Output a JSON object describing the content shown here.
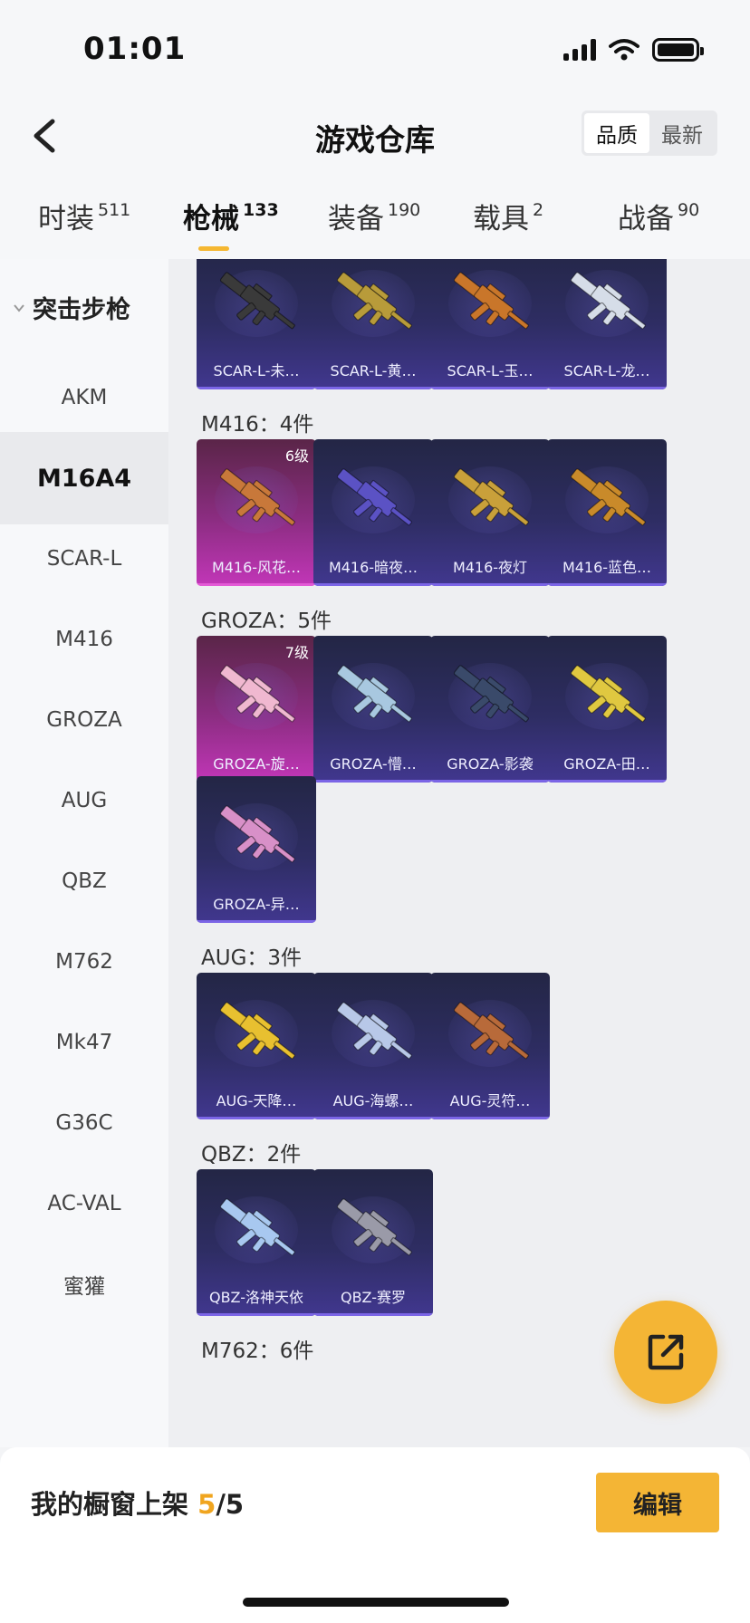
{
  "status": {
    "time": "01:01"
  },
  "nav": {
    "title": "游戏仓库",
    "sort_options": [
      "品质",
      "最新"
    ],
    "sort_active": 0
  },
  "categories": [
    {
      "label": "时装",
      "count": "511"
    },
    {
      "label": "枪械",
      "count": "133"
    },
    {
      "label": "装备",
      "count": "190"
    },
    {
      "label": "载具",
      "count": "2"
    },
    {
      "label": "战备",
      "count": "90"
    }
  ],
  "sidebar": {
    "group": "突击步枪",
    "items": [
      "AKM",
      "M16A4",
      "SCAR-L",
      "M416",
      "GROZA",
      "AUG",
      "QBZ",
      "M762",
      "Mk47",
      "G36C",
      "AC-VAL",
      "蜜獾"
    ],
    "active": "M16A4"
  },
  "sections": [
    {
      "label": "",
      "cards": [
        {
          "name": "SCAR-L-未…",
          "level": "",
          "color": "#3a3a3a"
        },
        {
          "name": "SCAR-L-黄…",
          "level": "",
          "color": "#b89b3a"
        },
        {
          "name": "SCAR-L-玉…",
          "level": "",
          "color": "#c9762a"
        },
        {
          "name": "SCAR-L-龙…",
          "level": "",
          "color": "#d6dde8"
        }
      ]
    },
    {
      "label": "M416：4件",
      "cards": [
        {
          "name": "M416-风花…",
          "level": "6级",
          "color": "#c8783a",
          "purple": true
        },
        {
          "name": "M416-暗夜…",
          "level": "",
          "color": "#5b52c4"
        },
        {
          "name": "M416-夜灯",
          "level": "",
          "color": "#c9a03a"
        },
        {
          "name": "M416-蓝色…",
          "level": "",
          "color": "#c98a2a"
        }
      ]
    },
    {
      "label": "GROZA：5件",
      "cards": [
        {
          "name": "GROZA-旋…",
          "level": "7级",
          "color": "#f0b8d0",
          "purple": true
        },
        {
          "name": "GROZA-懵…",
          "level": "",
          "color": "#a8c8e0"
        },
        {
          "name": "GROZA-影袭",
          "level": "",
          "color": "#3a4a6a"
        },
        {
          "name": "GROZA-田…",
          "level": "",
          "color": "#e0c840"
        },
        {
          "name": "GROZA-异…",
          "level": "",
          "color": "#d890c8"
        }
      ]
    },
    {
      "label": "AUG：3件",
      "cards": [
        {
          "name": "AUG-天降…",
          "level": "",
          "color": "#e8c030"
        },
        {
          "name": "AUG-海螺…",
          "level": "",
          "color": "#b8c8e8"
        },
        {
          "name": "AUG-灵符…",
          "level": "",
          "color": "#b86a3a"
        }
      ]
    },
    {
      "label": "QBZ：2件",
      "cards": [
        {
          "name": "QBZ-洛神天依",
          "level": "",
          "color": "#a8c8f0"
        },
        {
          "name": "QBZ-赛罗",
          "level": "",
          "color": "#9a9aa8"
        }
      ]
    },
    {
      "label": "M762：6件",
      "cards": []
    }
  ],
  "bottom": {
    "shelf_label": "我的橱窗上架",
    "shelf_current": "5",
    "shelf_total": "/5",
    "edit_label": "编辑"
  }
}
